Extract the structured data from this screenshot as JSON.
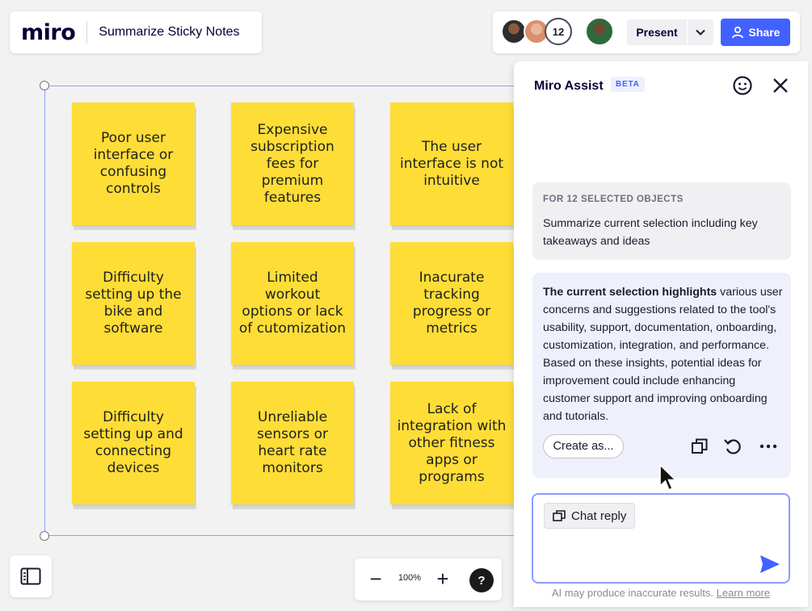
{
  "app": {
    "logo": "miro",
    "board_title": "Summarize Sticky Notes"
  },
  "collab": {
    "avatar_count": "12",
    "present_label": "Present",
    "share_label": "Share",
    "share_color": "#4262ff"
  },
  "stickies": [
    "Poor user interface or confusing controls",
    "Expensive subscription fees for premium features",
    "The user interface is not intuitive",
    "Difficulty setting up the bike and software",
    "Limited workout options or lack of cutomization",
    "Inacurate tracking progress or metrics",
    "Difficulty setting up and connecting devices",
    "Unreliable sensors or heart rate monitors",
    "Lack of integration with other fitness apps or programs"
  ],
  "sticky_color": "#fedd37",
  "zoom": {
    "level": "100%",
    "minus": "−",
    "plus": "+",
    "help": "?"
  },
  "assist": {
    "title": "Miro Assist",
    "beta": "BETA",
    "prompt_label": "FOR 12 SELECTED OBJECTS",
    "prompt_text": "Summarize current selection including key takeaways and ideas",
    "answer_bold": "The current selection highlights",
    "answer_rest": " various user concerns and suggestions related to the tool's usability, support, documentation, onboarding, customization, integration, and performance. Based on these insights, potential ideas for improvement could include enhancing customer support and improving onboarding and tutorials.",
    "create_label": "Create as...",
    "chip_label": "Chat reply",
    "disclaimer": "AI may produce inaccurate results.",
    "learn_more": "Learn more"
  }
}
